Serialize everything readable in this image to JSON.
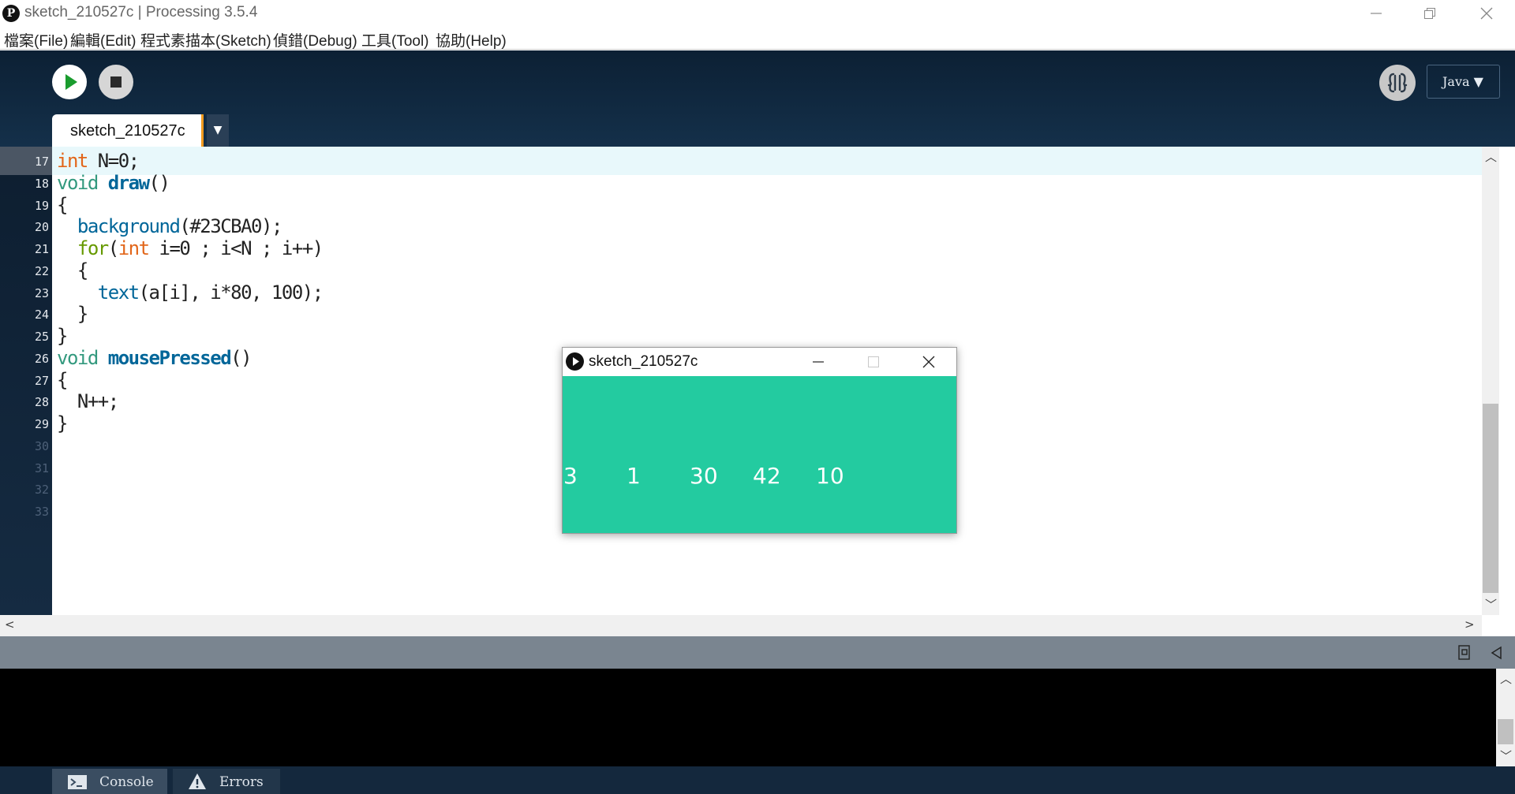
{
  "window": {
    "title": "sketch_210527c | Processing 3.5.4",
    "logo_glyph": "P"
  },
  "menu": [
    "檔案(File)",
    "編輯(Edit)",
    "程式素描本(Sketch)",
    "偵錯(Debug)",
    "工具(Tool)",
    "協助(Help)"
  ],
  "toolbar": {
    "mode": "Java ▼",
    "icons": [
      "run-icon",
      "stop-icon",
      "debugger-icon"
    ]
  },
  "tabs": {
    "active": "sketch_210527c",
    "menu_arrow": "▼"
  },
  "editor": {
    "line_numbers": [
      "17",
      "18",
      "19",
      "20",
      "21",
      "22",
      "23",
      "24",
      "25",
      "26",
      "27",
      "28",
      "29",
      "30",
      "31",
      "32",
      "33"
    ],
    "lines": {
      "l17_kw": "int",
      "l17_rest": " N=0;",
      "l18_kw": "void",
      "l18_sp": " ",
      "l18_fn": "draw",
      "l18_rest": "()",
      "l19": "{",
      "l20_indent": "  ",
      "l20_fn": "background",
      "l20_rest": "(#23CBA0);",
      "l21_indent": "  ",
      "l21_kw": "for",
      "l21_p": "(",
      "l21_type": "int",
      "l21_rest": " i=0 ; i<N ; i++)",
      "l22": "  {",
      "l23_indent": "    ",
      "l23_fn": "text",
      "l23_rest": "(a[i], i*80, 100);",
      "l24": "  }",
      "l25": "}",
      "l26_kw": "void",
      "l26_sp": " ",
      "l26_fn": "mousePressed",
      "l26_rest": "()",
      "l27": "{",
      "l28": "  N++;",
      "l29": "}"
    }
  },
  "console": {
    "tabs": [
      "Console",
      "Errors"
    ]
  },
  "sketch_window": {
    "title": "sketch_210527c",
    "background": "#23CBA0",
    "numbers": [
      "3",
      "1",
      "30",
      "42",
      "10"
    ]
  },
  "colors": {
    "toolbar_bg": "#0c2034",
    "accent_tab": "#f39b1e",
    "sketch_bg": "#23cba0"
  }
}
